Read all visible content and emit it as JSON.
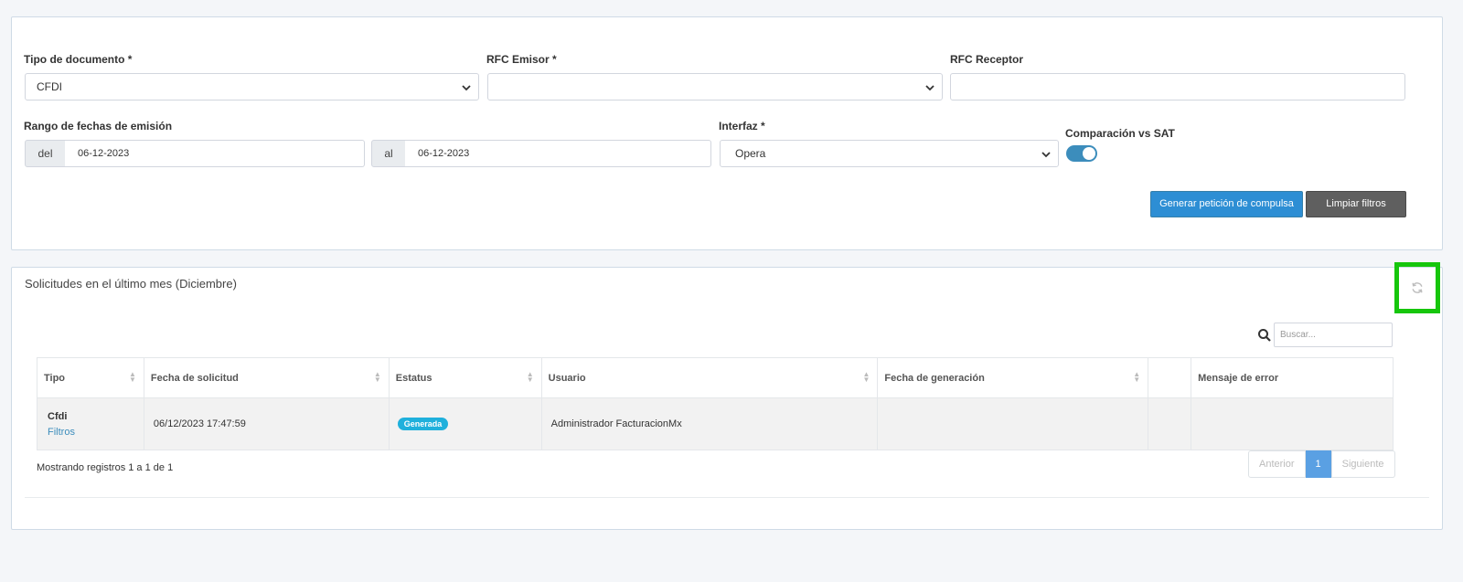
{
  "filters": {
    "tipo_documento": {
      "label": "Tipo de documento *",
      "value": "CFDI"
    },
    "rfc_emisor": {
      "label": "RFC Emisor *",
      "value": ""
    },
    "rfc_receptor": {
      "label": "RFC Receptor",
      "value": ""
    },
    "rango_fechas": {
      "label": "Rango de fechas de emisión",
      "del_label": "del",
      "del_value": "06-12-2023",
      "al_label": "al",
      "al_value": "06-12-2023"
    },
    "interfaz": {
      "label": "Interfaz *",
      "value": "Opera"
    },
    "comparacion": {
      "label": "Comparación vs SAT",
      "enabled": true
    },
    "buttons": {
      "generar": "Generar petición de compulsa",
      "limpiar": "Limpiar filtros"
    }
  },
  "results": {
    "title": "Solicitudes en el último mes (Diciembre)",
    "refresh_icon": "refresh-icon",
    "search_placeholder": "Buscar...",
    "columns": [
      "Tipo",
      "Fecha de solicitud",
      "Estatus",
      "Usuario",
      "Fecha de generación",
      "",
      "Mensaje de error"
    ],
    "rows": [
      {
        "tipo": "Cfdi",
        "tipo_link": "Filtros",
        "fecha_solicitud": "06/12/2023 17:47:59",
        "estatus": "Generada",
        "usuario": "Administrador FacturacionMx",
        "fecha_generacion": "",
        "extra": "",
        "mensaje_error": ""
      }
    ],
    "summary": "Mostrando registros 1 a 1 de 1",
    "pagination": {
      "prev": "Anterior",
      "current": "1",
      "next": "Siguiente"
    }
  },
  "colors": {
    "primary": "#2d8ed4",
    "badge": "#1fb0dc",
    "highlight": "#16c60c"
  }
}
